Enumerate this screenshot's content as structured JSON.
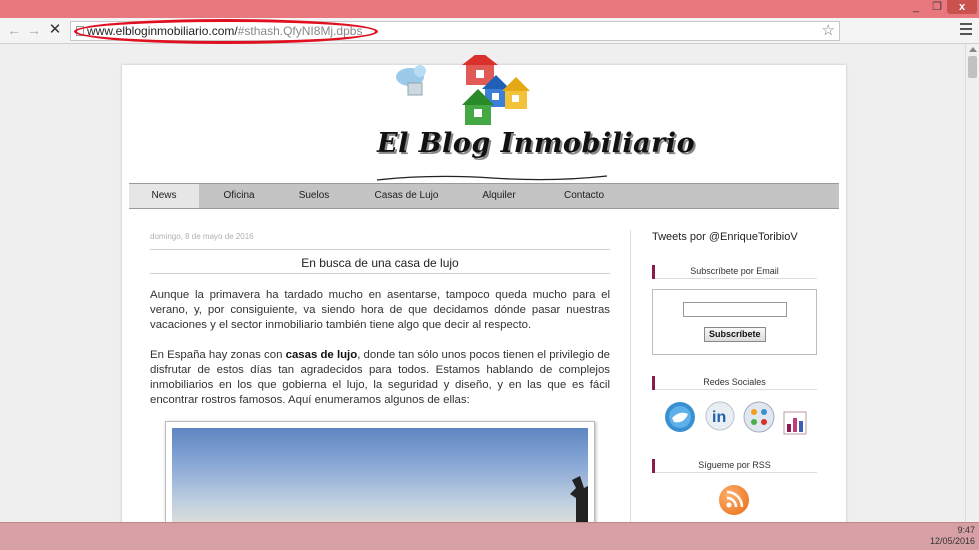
{
  "browser": {
    "url_host": "www.elbloginmobiliario.com/",
    "url_rest": "#sthash.QfyNI8Mj.dpbs",
    "window_controls": {
      "minimize": "_",
      "maximize": "❐",
      "close": "x"
    }
  },
  "blog": {
    "title": "El Blog Inmobiliario",
    "nav": [
      "News",
      "Oficina",
      "Suelos",
      "Casas de Lujo",
      "Alquiler",
      "Contacto"
    ],
    "active_nav": "News",
    "post": {
      "date": "domingo, 8 de mayo de 2016",
      "title": "En busca de una casa de lujo",
      "p1": "Aunque la primavera ha tardado mucho en asentarse, tampoco queda mucho para el verano, y, por consiguiente, va siendo hora de que decidamos dónde pasar nuestras vacaciones y el sector inmobiliario también tiene algo que decir al respecto.",
      "p2_before": "En España hay zonas con ",
      "p2_bold": "casas de lujo",
      "p2_after": ", donde tan sólo unos pocos tienen el privilegio de disfrutar de estos días tan agradecidos para todos. Estamos hablando de complejos inmobiliarios en los que gobierna el lujo, la seguridad y diseño, y en las que es fácil encontrar rostros famosos. Aquí enumeramos algunos de ellas:"
    },
    "sidebar": {
      "tweets": "Tweets por @EnriqueToribioV",
      "email_heading": "Subscríbete por Email",
      "email_button": "Subscríbete",
      "social_heading": "Redes Sociales",
      "social_icons": [
        "twitter-icon",
        "linkedin-icon",
        "delicious-icon",
        "analytics-icon"
      ],
      "rss_heading": "Sígueme por RSS"
    }
  },
  "taskbar": {
    "time": "9:47",
    "date": "12/05/2016"
  }
}
